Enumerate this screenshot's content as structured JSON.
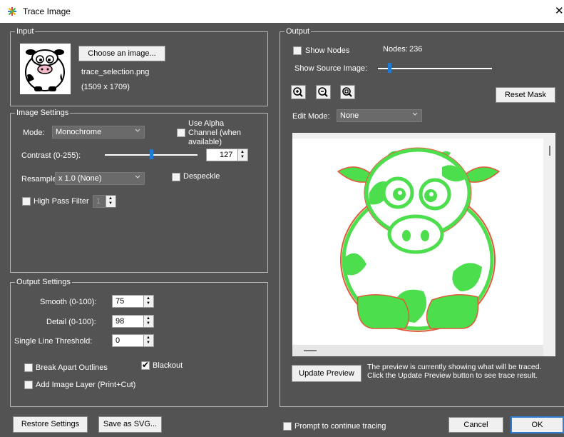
{
  "window": {
    "title": "Trace Image",
    "close_glyph": "✕",
    "app_icon": "colorful-star-icon"
  },
  "input": {
    "legend": "Input",
    "choose_button": "Choose an image...",
    "filename": "trace_selection.png",
    "dimensions": "(1509 x 1709)"
  },
  "image_settings": {
    "legend": "Image Settings",
    "mode_label": "Mode:",
    "mode_value": "Monochrome",
    "alpha_label_line1": "Use Alpha",
    "alpha_label_line2": "Channel (when",
    "alpha_label_line3": "available)",
    "use_alpha_checked": false,
    "contrast_label": "Contrast (0-255):",
    "contrast_value": "127",
    "contrast_fraction": 0.498,
    "resample_label": "Resample:",
    "resample_value": "x 1.0 (None)",
    "despeckle_label": "Despeckle",
    "despeckle_checked": false,
    "highpass_label": "High Pass Filter",
    "highpass_checked": false,
    "highpass_value": "1"
  },
  "output_settings": {
    "legend": "Output Settings",
    "smooth_label": "Smooth (0-100):",
    "smooth_value": "75",
    "detail_label": "Detail (0-100):",
    "detail_value": "98",
    "single_line_label": "Single Line Threshold:",
    "single_line_value": "0",
    "break_apart_label": "Break Apart Outlines",
    "break_apart_checked": false,
    "blackout_label": "Blackout",
    "blackout_checked": true,
    "add_layer_label": "Add Image Layer (Print+Cut)",
    "add_layer_checked": false
  },
  "output": {
    "legend": "Output",
    "show_nodes_label": "Show Nodes",
    "show_nodes_checked": false,
    "nodes_label": "Nodes:",
    "nodes_value": "236",
    "show_source_label": "Show Source Image:",
    "show_source_fraction": 0.1,
    "zoom_in_icon": "zoom-in-icon",
    "zoom_out_icon": "zoom-out-icon",
    "zoom_fit_icon": "zoom-fit-icon",
    "reset_mask_button": "Reset Mask",
    "edit_mode_label": "Edit Mode:",
    "edit_mode_value": "None",
    "update_preview_button": "Update Preview",
    "preview_note": "The preview is currently showing what will be traced. Click the Update Preview button to see trace result.",
    "trace_fill_color": "#4dde4d",
    "trace_outline_color": "#e05a3a"
  },
  "footer": {
    "restore_button": "Restore Settings",
    "save_svg_button": "Save as SVG...",
    "prompt_label": "Prompt to continue tracing",
    "prompt_checked": false,
    "cancel_button": "Cancel",
    "ok_button": "OK"
  }
}
